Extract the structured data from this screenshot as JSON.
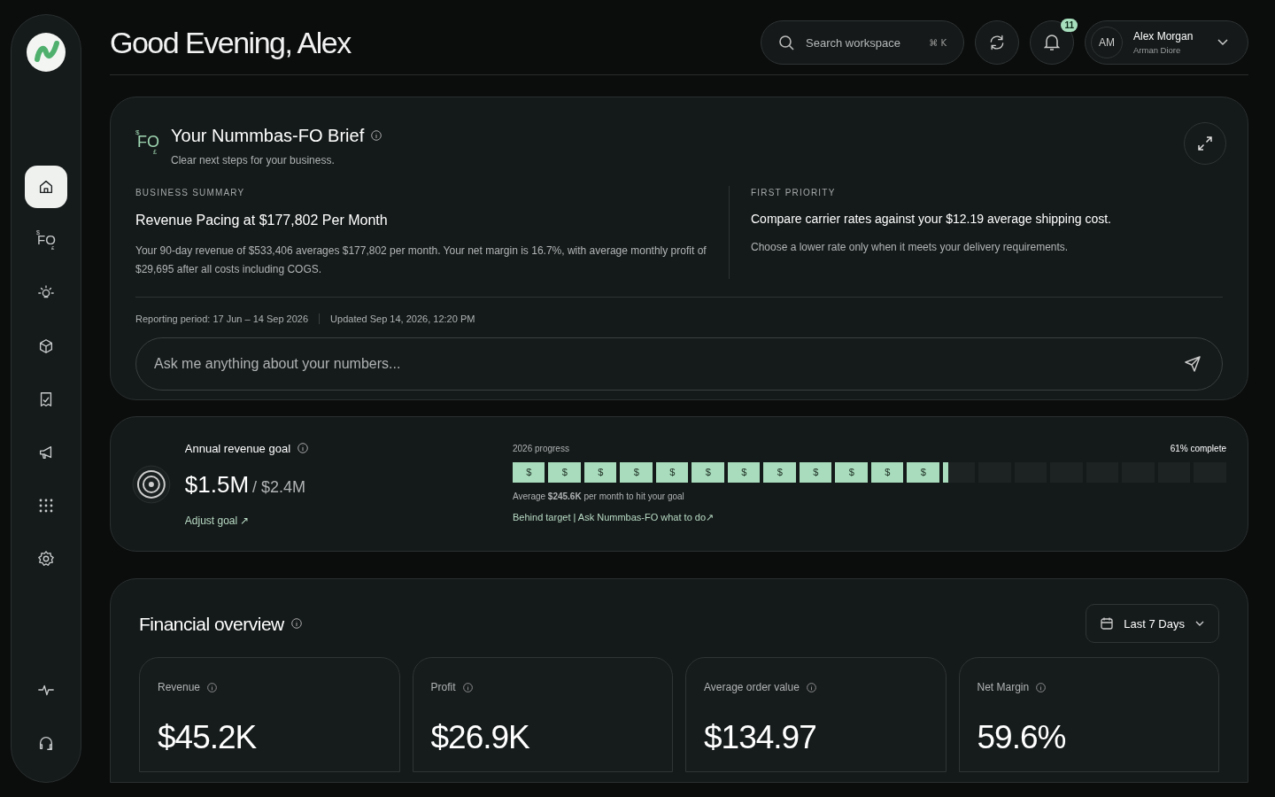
{
  "sidebar": {
    "items": [
      {
        "kind": "home",
        "selected": true
      },
      {
        "kind": "fo",
        "selected": false,
        "top": "$",
        "main": "FO",
        "bottom": "£"
      },
      {
        "kind": "bulb",
        "selected": false
      },
      {
        "kind": "cube",
        "selected": false
      },
      {
        "kind": "receipt",
        "selected": false
      },
      {
        "kind": "megaphone",
        "selected": false
      },
      {
        "kind": "grid",
        "selected": false
      },
      {
        "kind": "settings",
        "selected": false
      }
    ],
    "bottom_items": [
      {
        "kind": "activity",
        "selected": false
      },
      {
        "kind": "headset",
        "selected": false
      }
    ]
  },
  "header": {
    "greeting": "Good Evening, Alex",
    "search": {
      "placeholder": "Search workspace",
      "shortcut": "⌘ K"
    },
    "notifications": "11",
    "user": {
      "initials": "AM",
      "name": "Alex Morgan",
      "subtitle": "Arman Diore"
    }
  },
  "brief": {
    "logo": {
      "top": "$",
      "main": "FO",
      "bottom": "£"
    },
    "title": "Your Nummbas-FO Brief",
    "subtitle": "Clear next steps for your business.",
    "summary": {
      "label": "BUSINESS SUMMARY",
      "heading": "Revenue Pacing at $177,802 Per Month",
      "body": "Your 90-day revenue of $533,406 averages $177,802 per month. Your net margin is 16.7%, with average monthly profit of $29,695 after all costs including COGS."
    },
    "priority": {
      "label": "FIRST PRIORITY",
      "heading": "Compare carrier rates against your $12.19 average shipping cost.",
      "body": "Choose a lower rate only when it meets your delivery requirements."
    },
    "reporting_period": "Reporting period: 17 Jun – 14 Sep 2026",
    "updated": "Updated Sep 14, 2026, 12:20 PM",
    "ask_placeholder": "Ask me anything about your numbers..."
  },
  "goal": {
    "label": "Annual revenue goal",
    "value": "$1.5M",
    "target": "/ $2.4M",
    "adjust": "Adjust goal ↗",
    "progress_label": "2026 progress",
    "complete": "61% complete",
    "level": 0.61,
    "segment_symbol": "$",
    "average": "Average **$245.6K** per month to hit your goal",
    "link": "Behind target | Ask Nummbas-FO what to do↗"
  },
  "overview": {
    "title": "Financial overview",
    "range": "Last 7 Days",
    "metrics": [
      {
        "label": "Revenue",
        "value": "$45.2K"
      },
      {
        "label": "Profit",
        "value": "$26.9K"
      },
      {
        "label": "Average order value",
        "value": "$134.97"
      },
      {
        "label": "Net Margin",
        "value": "59.6%"
      }
    ]
  }
}
